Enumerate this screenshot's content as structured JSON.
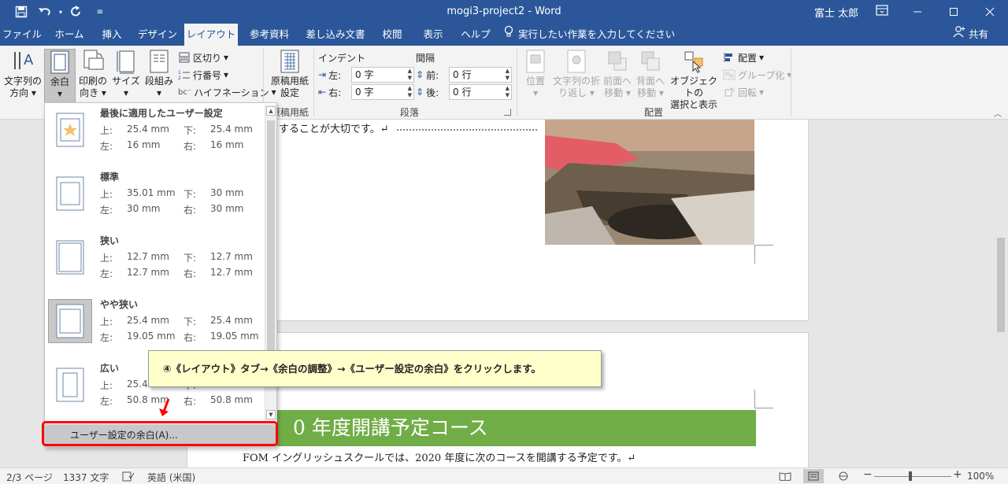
{
  "titlebar": {
    "doc_title": "mogi3-project2 - Word",
    "user": "富士 太郎",
    "qat": [
      "save-icon",
      "undo-icon",
      "redo-icon",
      "customize-icon"
    ],
    "window_buttons": [
      "minimize",
      "restore",
      "close"
    ]
  },
  "tabs": [
    {
      "label": "ファイル",
      "active": false
    },
    {
      "label": "ホーム",
      "active": false
    },
    {
      "label": "挿入",
      "active": false
    },
    {
      "label": "デザイン",
      "active": false
    },
    {
      "label": "レイアウト",
      "active": true
    },
    {
      "label": "参考資料",
      "active": false
    },
    {
      "label": "差し込み文書",
      "active": false
    },
    {
      "label": "校閲",
      "active": false
    },
    {
      "label": "表示",
      "active": false
    },
    {
      "label": "ヘルプ",
      "active": false
    }
  ],
  "tell_me": "実行したい作業を入力してください",
  "share": "共有",
  "ribbon": {
    "text_direction": {
      "line1": "文字列の",
      "line2": "方向"
    },
    "margins": "余白",
    "orientation": {
      "line1": "印刷の",
      "line2": "向き"
    },
    "size": "サイズ",
    "columns": "段組み",
    "breaks": "区切り",
    "line_numbers": "行番号",
    "hyphenation": "ハイフネーション",
    "genko": {
      "line1": "原稿用紙",
      "line2": "設定"
    },
    "genko_group": "原稿用紙",
    "indent_label": "インデント",
    "spacing_label": "間隔",
    "indent_left_label": "左:",
    "indent_left_value": "0 字",
    "indent_right_label": "右:",
    "indent_right_value": "0 字",
    "space_before_label": "前:",
    "space_before_value": "0 行",
    "space_after_label": "後:",
    "space_after_value": "0 行",
    "paragraph_group": "段落",
    "position": "位置",
    "wrap_text": {
      "line1": "文字列の折",
      "line2": "り返し"
    },
    "bring_forward": {
      "line1": "前面へ",
      "line2": "移動"
    },
    "send_backward": {
      "line1": "背面へ",
      "line2": "移動"
    },
    "selection_pane": {
      "line1": "オブジェクトの",
      "line2": "選択と表示"
    },
    "align": "配置",
    "group": "グループ化",
    "rotate": "回転",
    "arrange_group": "配置"
  },
  "margins_dropdown": {
    "presets": [
      {
        "name": "最後に適用したユーザー設定",
        "top_label": "上:",
        "top": "25.4 mm",
        "bottom_label": "下:",
        "bottom": "25.4 mm",
        "left_label": "左:",
        "left": "16 mm",
        "right_label": "右:",
        "right": "16 mm"
      },
      {
        "name": "標準",
        "top_label": "上:",
        "top": "35.01 mm",
        "bottom_label": "下:",
        "bottom": "30 mm",
        "left_label": "左:",
        "left": "30 mm",
        "right_label": "右:",
        "right": "30 mm"
      },
      {
        "name": "狭い",
        "top_label": "上:",
        "top": "12.7 mm",
        "bottom_label": "下:",
        "bottom": "12.7 mm",
        "left_label": "左:",
        "left": "12.7 mm",
        "right_label": "右:",
        "right": "12.7 mm"
      },
      {
        "name": "やや狭い",
        "top_label": "上:",
        "top": "25.4 mm",
        "bottom_label": "下:",
        "bottom": "25.4 mm",
        "left_label": "左:",
        "left": "19.05 mm",
        "right_label": "右:",
        "right": "19.05 mm"
      },
      {
        "name": "広い",
        "top_label": "上:",
        "top": "25.4",
        "bottom_label": "下:",
        "bottom": "",
        "left_label": "左:",
        "left": "50.8 mm",
        "right_label": "右:",
        "right": "50.8 mm"
      }
    ],
    "custom": "ユーザー設定の余白(A)..."
  },
  "callout": "④《レイアウト》タブ→《余白の調整》→《ユーザー設定の余白》をクリックします。",
  "document": {
    "page1_text": "することが大切です。↵",
    "heading_text": "0 年度開講予定コース",
    "page2_text": "FOM イングリッシュスクールでは、2020 年度に次のコースを開講する予定です。↵"
  },
  "statusbar": {
    "page": "2/3 ページ",
    "words": "1337 文字",
    "language": "英語 (米国)",
    "zoom": "100%",
    "minus": "−",
    "plus": "+"
  },
  "colors": {
    "word_blue": "#2b579a",
    "callout_bg": "#ffffcc",
    "highlight_red": "#ff0000",
    "heading_green": "#70ad47"
  }
}
